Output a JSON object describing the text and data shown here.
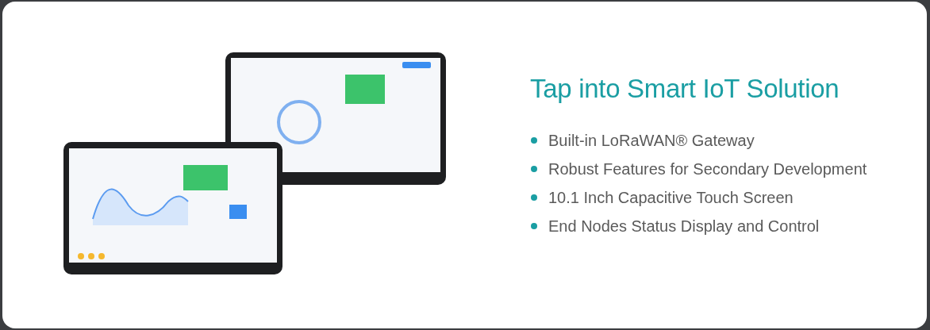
{
  "heading": "Tap into Smart IoT Solution",
  "features": [
    "Built-in LoRaWAN® Gateway",
    "Robust Features for Secondary Development",
    "10.1 Inch Capacitive Touch Screen",
    "End Nodes Status Display and Control"
  ]
}
